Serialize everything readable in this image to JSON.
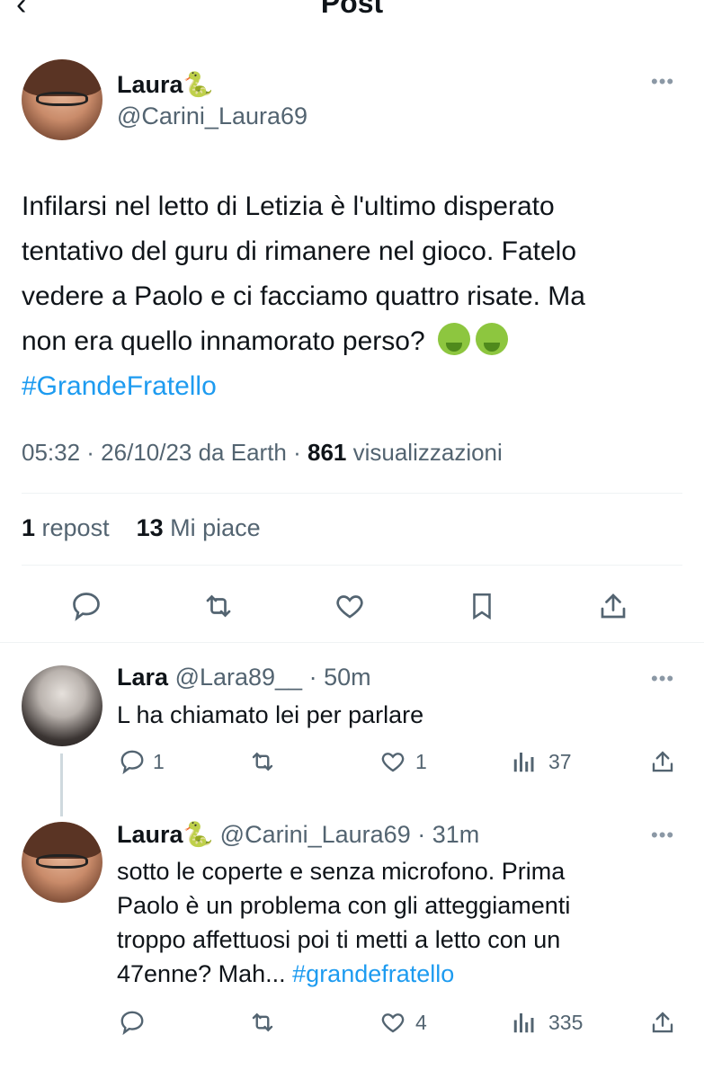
{
  "header": {
    "title": "Post"
  },
  "post": {
    "author_name": "Laura🐍",
    "author_handle": "@Carini_Laura69",
    "text_lines": [
      "Infilarsi nel letto di Letizia è l'ultimo disperato",
      "tentativo del guru di rimanere nel gioco. Fatelo",
      "vedere a Paolo e ci facciamo quattro risate. Ma",
      "non era quello innamorato perso?"
    ],
    "hashtag": "#GrandeFratello",
    "time": "05:32 · 26/10/23 da Earth · ",
    "views_count": "861",
    "views_label": " visualizzazioni",
    "reposts_count": "1",
    "reposts_label": " repost",
    "likes_count": "13",
    "likes_label": " Mi piace"
  },
  "replies": [
    {
      "name": "Lara",
      "meta": "@Lara89__ · 50m",
      "text_lines": [
        "L ha chiamato lei per parlare"
      ],
      "replies": "1",
      "reposts": "",
      "likes": "1",
      "views": "37"
    },
    {
      "name": "Laura🐍",
      "meta": "@Carini_Laura69 · 31m",
      "text_lines": [
        "sotto le coperte e senza microfono. Prima",
        "Paolo è un problema con gli atteggiamenti",
        "troppo affettuosi poi ti metti a letto con un",
        "47enne? Mah... "
      ],
      "hashtag": "#grandefratello",
      "replies": "",
      "reposts": "",
      "likes": "4",
      "views": "335"
    }
  ],
  "icons": [
    "back-arrow-icon",
    "more-icon",
    "reply-icon",
    "repost-icon",
    "like-icon",
    "bookmark-icon",
    "share-icon",
    "views-icon",
    "nauseated-face-emoji"
  ],
  "colors": {
    "text": "#0f1419",
    "secondary": "#536471",
    "link": "#1d9bf0",
    "divider": "#eff3f4"
  }
}
